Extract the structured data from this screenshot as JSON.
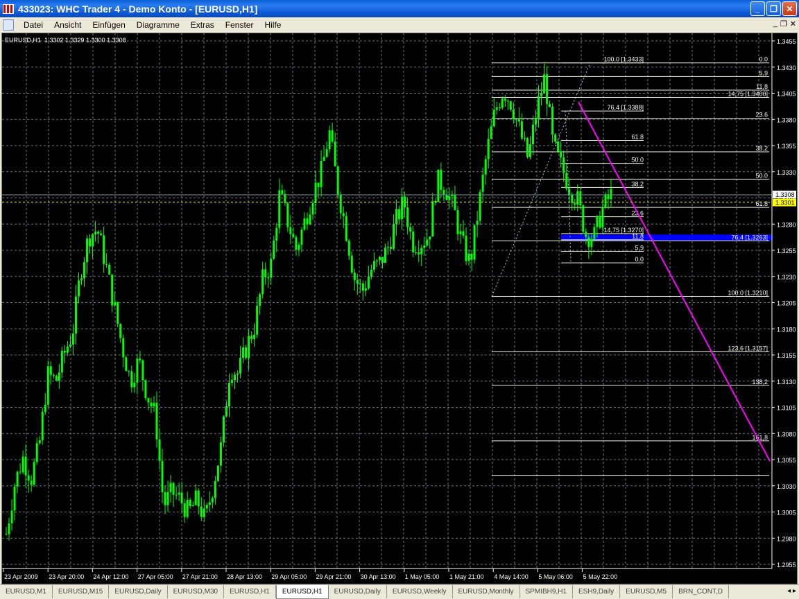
{
  "window": {
    "title": "433023: WHC Trader 4 - Demo Konto - [EURUSD,H1]"
  },
  "menu": [
    "Datei",
    "Ansicht",
    "Einfügen",
    "Diagramme",
    "Extras",
    "Fenster",
    "Hilfe"
  ],
  "chart_info": "EURUSD,H1  1.3302 1.3329 1.3300 1.3308",
  "colors": {
    "candle": "#00ff00",
    "grid": "#6a7a8a",
    "fib": "#f5f5dc",
    "trend": "#ff00ff",
    "bid": "#ffff00",
    "highlight": "#0000ff"
  },
  "chart_data": {
    "type": "candlestick",
    "symbol": "EURUSD",
    "timeframe": "H1",
    "ylim": [
      1.2945,
      1.3466
    ],
    "y_ticks": [
      "1.3455",
      "1.3430",
      "1.3405",
      "1.3380",
      "1.3355",
      "1.3330",
      "1.3305",
      "1.3280",
      "1.3255",
      "1.3230",
      "1.3205",
      "1.3180",
      "1.3155",
      "1.3130",
      "1.3105",
      "1.3080",
      "1.3055",
      "1.3030",
      "1.3005",
      "1.2980",
      "1.2955"
    ],
    "x_ticks": [
      "23 Apr 2009",
      "23 Apr 20:00",
      "24 Apr 12:00",
      "27 Apr 05:00",
      "27 Apr 21:00",
      "28 Apr 13:00",
      "29 Apr 05:00",
      "29 Apr 21:00",
      "30 Apr 13:00",
      "1 May 05:00",
      "1 May 21:00",
      "4 May 14:00",
      "5 May 06:00",
      "5 May 22:00"
    ],
    "close_path": [
      1.2984,
      1.3031,
      1.3057,
      1.3037,
      1.307,
      1.3136,
      1.313,
      1.3156,
      1.3176,
      1.3236,
      1.3269,
      1.3275,
      1.3242,
      1.3203,
      1.3163,
      1.313,
      1.315,
      1.3117,
      1.3097,
      1.3011,
      1.3024,
      1.3017,
      1.3004,
      1.3017,
      1.2997,
      1.3031,
      1.307,
      1.3143,
      1.3137,
      1.3163,
      1.3183,
      1.3229,
      1.3242,
      1.3309,
      1.3282,
      1.3256,
      1.3282,
      1.3309,
      1.3329,
      1.3368,
      1.3315,
      1.3275,
      1.3229,
      1.3216,
      1.3236,
      1.3242,
      1.3256,
      1.3282,
      1.3302,
      1.3262,
      1.3262,
      1.3269,
      1.3322,
      1.3315,
      1.3295,
      1.3262,
      1.3242,
      1.3295,
      1.3348,
      1.3388,
      1.3408,
      1.3395,
      1.3368,
      1.3342,
      1.3388,
      1.3421,
      1.3355,
      1.3335,
      1.3315,
      1.3302,
      1.3269,
      1.3269,
      1.3295,
      1.3308
    ],
    "current_ask": "1.3308",
    "current_bid": "1.3301",
    "fib_expansion": [
      {
        "label": "0.0",
        "price": 1.3434
      },
      {
        "label": "5,9",
        "price": 1.3421
      },
      {
        "label": "11,8",
        "price": 1.3408
      },
      {
        "label": "14,75 [1.3400]",
        "price": 1.3401
      },
      {
        "label": "23.6",
        "price": 1.3381
      },
      {
        "label": "38.2",
        "price": 1.3349
      },
      {
        "label": "50.0",
        "price": 1.3323
      },
      {
        "label": "61.8",
        "price": 1.3296
      },
      {
        "label": "76,4 [1.3263]",
        "price": 1.3264
      },
      {
        "label": "100.0 [1.3210]",
        "price": 1.3211
      },
      {
        "label": "123,6 [1.3157]",
        "price": 1.3158
      },
      {
        "label": "138,2",
        "price": 1.3126
      },
      {
        "label": "161,8",
        "price": 1.3073
      },
      {
        "label": "",
        "price": 1.304
      }
    ],
    "fib_retracement": [
      {
        "label": "100.0 [1.3433]",
        "price": 1.3434
      },
      {
        "label": "76,4 [1.3388]",
        "price": 1.3388
      },
      {
        "label": "61.8",
        "price": 1.336
      },
      {
        "label": "50.0",
        "price": 1.3338
      },
      {
        "label": "38.2",
        "price": 1.3315
      },
      {
        "label": "23.6",
        "price": 1.3287
      },
      {
        "label": "14,75 [1.3270]",
        "price": 1.3271
      },
      {
        "label": "11,8",
        "price": 1.3265
      },
      {
        "label": "5,9",
        "price": 1.3254
      },
      {
        "label": "0.0",
        "price": 1.3243
      }
    ]
  },
  "tabs": [
    {
      "label": "EURUSD,M1"
    },
    {
      "label": "EURUSD,M15"
    },
    {
      "label": "EURUSD,Daily"
    },
    {
      "label": "EURUSD,M30"
    },
    {
      "label": "EURUSD,H1"
    },
    {
      "label": "EURUSD,H1",
      "active": true
    },
    {
      "label": "EURUSD,Daily"
    },
    {
      "label": "EURUSD,Weekly"
    },
    {
      "label": "EURUSD,Monthly"
    },
    {
      "label": "SPMIBH9,H1"
    },
    {
      "label": "ESH9,Daily"
    },
    {
      "label": "EURUSD,M5"
    },
    {
      "label": "BRN_CONT,D"
    }
  ]
}
